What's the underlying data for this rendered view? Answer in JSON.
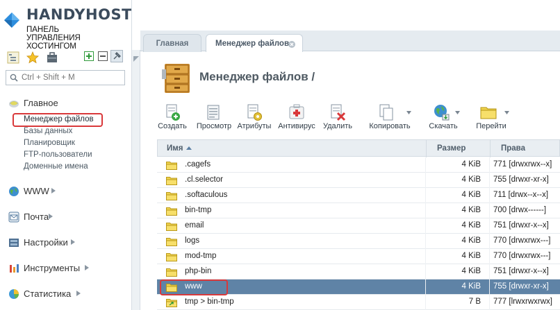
{
  "brand": {
    "name": "HANDYHOST",
    "subtitle": [
      "ПАНЕЛЬ",
      "УПРАВЛЕНИЯ",
      "ХОСТИНГОМ"
    ]
  },
  "search": {
    "placeholder": "Ctrl + Shift + M"
  },
  "sidebar": {
    "sections": [
      {
        "label": "Главное",
        "icon": "home-icon",
        "expanded": true,
        "items": [
          "Менеджер файлов",
          "Базы данных",
          "Планировщик",
          "FTP-пользователи",
          "Доменные имена"
        ],
        "active": "Менеджер файлов"
      },
      {
        "label": "WWW",
        "icon": "globe-icon",
        "expanded": false
      },
      {
        "label": "Почта",
        "icon": "mail-icon",
        "expanded": false
      },
      {
        "label": "Настройки",
        "icon": "settings-icon",
        "expanded": false
      },
      {
        "label": "Инструменты",
        "icon": "tools-icon",
        "expanded": false
      },
      {
        "label": "Статистика",
        "icon": "stats-icon",
        "expanded": false
      }
    ]
  },
  "tabs": [
    {
      "label": "Главная",
      "active": false
    },
    {
      "label": "Менеджер файлов",
      "active": true,
      "closable": true
    }
  ],
  "page": {
    "title": "Менеджер файлов /"
  },
  "toolbar": [
    {
      "label": "Создать",
      "icon": "create-icon"
    },
    {
      "label": "Просмотр",
      "icon": "view-icon"
    },
    {
      "label": "Атрибуты",
      "icon": "attributes-icon"
    },
    {
      "label": "Антивирус",
      "icon": "antivirus-icon"
    },
    {
      "label": "Удалить",
      "icon": "delete-icon"
    },
    {
      "label": "Копировать",
      "icon": "copy-icon",
      "dropdown": true
    },
    {
      "label": "Скачать",
      "icon": "download-icon",
      "dropdown": true
    },
    {
      "label": "Перейти",
      "icon": "goto-icon",
      "dropdown": true
    }
  ],
  "table": {
    "columns": {
      "name": "Имя",
      "size": "Размер",
      "rights": "Права"
    },
    "sort": {
      "column": "name",
      "direction": "asc"
    },
    "rows": [
      {
        "name": ".cagefs",
        "size": "4 KiB",
        "rights": "771 [drwxrwx--x]",
        "type": "folder"
      },
      {
        "name": ".cl.selector",
        "size": "4 KiB",
        "rights": "755 [drwxr-xr-x]",
        "type": "folder"
      },
      {
        "name": ".softaculous",
        "size": "4 KiB",
        "rights": "711 [drwx--x--x]",
        "type": "folder"
      },
      {
        "name": "bin-tmp",
        "size": "4 KiB",
        "rights": "700 [drwx------]",
        "type": "folder"
      },
      {
        "name": "email",
        "size": "4 KiB",
        "rights": "751 [drwxr-x--x]",
        "type": "folder"
      },
      {
        "name": "logs",
        "size": "4 KiB",
        "rights": "770 [drwxrwx---]",
        "type": "folder"
      },
      {
        "name": "mod-tmp",
        "size": "4 KiB",
        "rights": "770 [drwxrwx---]",
        "type": "folder"
      },
      {
        "name": "php-bin",
        "size": "4 KiB",
        "rights": "751 [drwxr-x--x]",
        "type": "folder"
      },
      {
        "name": "www",
        "size": "4 KiB",
        "rights": "755 [drwxr-xr-x]",
        "type": "folder",
        "selected": true
      },
      {
        "name": "tmp > bin-tmp",
        "size": "7 B",
        "rights": "777 [lrwxrwxrwx]",
        "type": "symlink"
      }
    ]
  },
  "colors": {
    "selection": "#5f83a6",
    "highlight": "#d9383a",
    "accent": "#2b8ad8"
  }
}
